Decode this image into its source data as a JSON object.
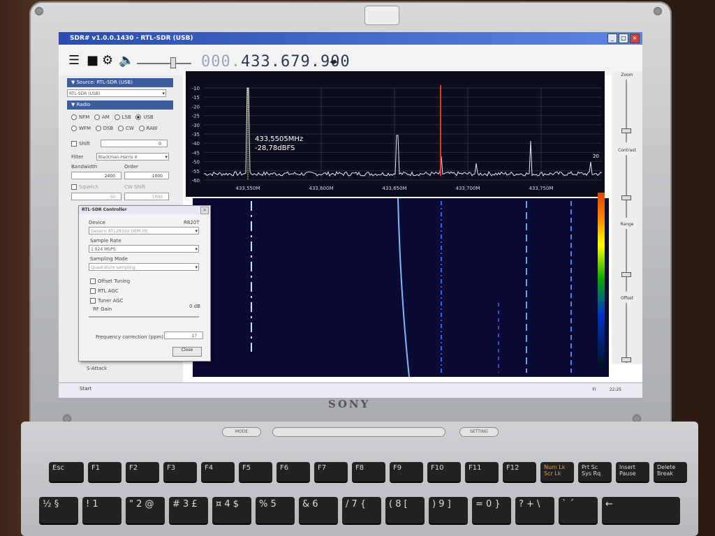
{
  "window": {
    "title": "SDR# v1.0.0.1430 - RTL-SDR (USB)",
    "btn_min": "_",
    "btn_max": "□",
    "btn_close": "×"
  },
  "toolbar": {
    "frequency_dim": "000.",
    "frequency": "433.679.900",
    "freq_arrows": "◂▸"
  },
  "source": {
    "header": "Source: RTL-SDR (USB)",
    "device": "RTL-SDR (USB)"
  },
  "radio": {
    "header": "Radio",
    "modes_row1": [
      "NFM",
      "AM",
      "LSB",
      "USB"
    ],
    "modes_row2": [
      "WFM",
      "DSB",
      "CW",
      "RAW"
    ],
    "selected_mode": "USB",
    "shift_label": "Shift",
    "shift_value": "0",
    "filter_label": "Filter",
    "filter_value": "Blackman-Harris 4",
    "bandwidth_label": "Bandwidth",
    "bandwidth_value": "2400",
    "order_label": "Order",
    "order_value": "1000",
    "squelch_label": "Squelch",
    "squelch_value": "50",
    "cw_shift_label": "CW Shift",
    "cw_shift_value": "1000",
    "s_attack": "S-Attack"
  },
  "spectrum": {
    "y_ticks": [
      "-10",
      "-15",
      "-20",
      "-25",
      "-30",
      "-35",
      "-40",
      "-45",
      "-50",
      "-55",
      "-60"
    ],
    "x_ticks": [
      "433,550M",
      "433,600M",
      "433,650M",
      "433,700M",
      "433,750M"
    ],
    "cursor_freq": "433,5505MHz",
    "cursor_level": "-28,78dBFS",
    "wf_label": "20"
  },
  "right_panel": {
    "zoom": "Zoom",
    "contrast": "Contrast",
    "range": "Range",
    "offset": "Offset"
  },
  "dialog": {
    "title": "RTL-SDR Controller",
    "device_label": "Device",
    "tuner": "R820T",
    "device_value": "Generic RTL2832U OEM (0)",
    "sample_rate_label": "Sample Rate",
    "sample_rate_value": "1.024 MSPS",
    "sampling_mode_label": "Sampling Mode",
    "sampling_mode_value": "Quadrature sampling",
    "offset_tuning": "Offset Tuning",
    "rtl_agc": "RTL AGC",
    "tuner_agc": "Tuner AGC",
    "rf_gain_label": "RF Gain",
    "rf_gain_value": "0 dB",
    "freq_corr_label": "Frequency correction (ppm)",
    "freq_corr_value": "17",
    "close": "Close"
  },
  "taskbar": {
    "start": "Start",
    "lang": "FI",
    "clock": "22:25"
  },
  "laptop": {
    "brand": "SONY",
    "mode_btn": "MODE",
    "setting_btn": "SETTING",
    "fn_keys": [
      "Esc",
      "F1",
      "F2",
      "F3",
      "F4",
      "F5",
      "F6",
      "F7",
      "F8",
      "F9",
      "F10",
      "F11",
      "F12",
      "Num Lk Scr Lk",
      "Prt Sc Sys Rq",
      "Insert Pause",
      "Delete Break"
    ],
    "num_keys": [
      "½ §",
      "! 1",
      "\" 2 @",
      "# 3 £",
      "¤ 4 $",
      "% 5",
      "& 6",
      "/ 7 {",
      "( 8 [",
      ") 9 ]",
      "= 0 }",
      "? + \\",
      "` ´",
      "←"
    ]
  }
}
